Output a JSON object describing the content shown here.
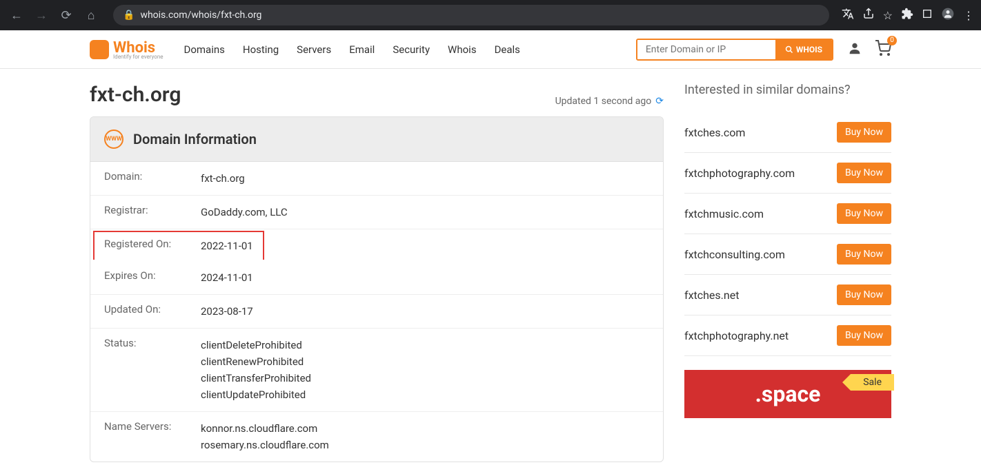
{
  "browser": {
    "url": "whois.com/whois/fxt-ch.org"
  },
  "nav": {
    "items": [
      "Domains",
      "Hosting",
      "Servers",
      "Email",
      "Security",
      "Whois",
      "Deals"
    ]
  },
  "search": {
    "placeholder": "Enter Domain or IP",
    "button": "WHOIS"
  },
  "cart": {
    "count": "0"
  },
  "page": {
    "title": "fxt-ch.org",
    "updated": "Updated 1 second ago"
  },
  "panel": {
    "title": "Domain Information"
  },
  "info": {
    "domain_label": "Domain:",
    "domain": "fxt-ch.org",
    "registrar_label": "Registrar:",
    "registrar": "GoDaddy.com, LLC",
    "registered_label": "Registered On:",
    "registered": "2022-11-01",
    "expires_label": "Expires On:",
    "expires": "2024-11-01",
    "updated_label": "Updated On:",
    "updated": "2023-08-17",
    "status_label": "Status:",
    "status1": "clientDeleteProhibited",
    "status2": "clientRenewProhibited",
    "status3": "clientTransferProhibited",
    "status4": "clientUpdateProhibited",
    "ns_label": "Name Servers:",
    "ns1": "konnor.ns.cloudflare.com",
    "ns2": "rosemary.ns.cloudflare.com"
  },
  "sidebar": {
    "title": "Interested in similar domains?",
    "buy": "Buy Now",
    "domains": [
      "fxtches.com",
      "fxtchphotography.com",
      "fxtchmusic.com",
      "fxtchconsulting.com",
      "fxtches.net",
      "fxtchphotography.net"
    ]
  },
  "promo": {
    "text": ".space",
    "sale": "Sale"
  },
  "logo": {
    "brand": "Whois",
    "tag": "Identify for everyone"
  }
}
